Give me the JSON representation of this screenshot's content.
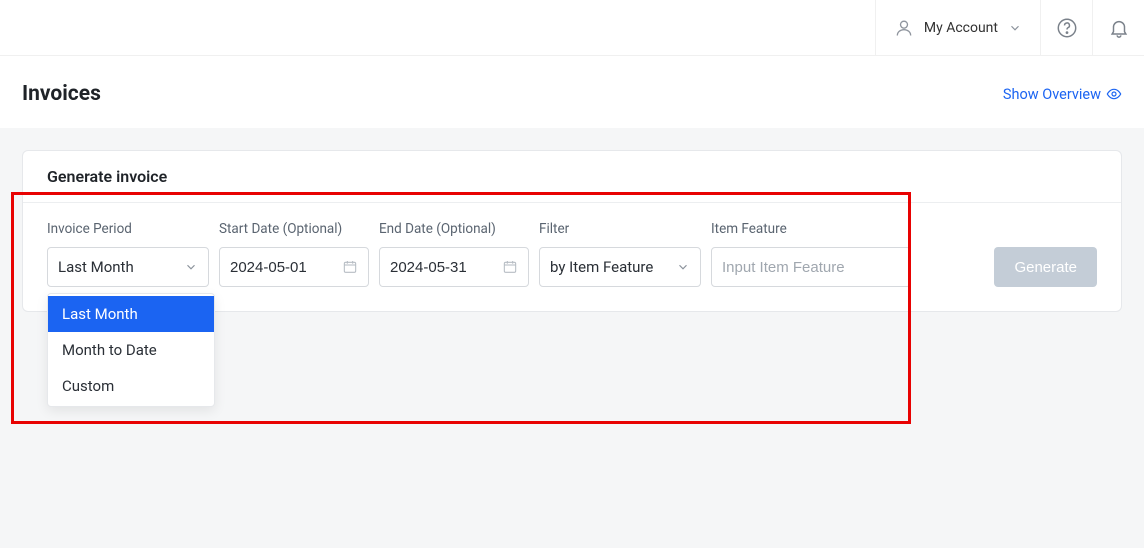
{
  "header": {
    "account_label": "My Account"
  },
  "page": {
    "title": "Invoices",
    "overview_label": "Show Overview"
  },
  "card": {
    "title": "Generate invoice"
  },
  "fields": {
    "invoice_period": {
      "label": "Invoice Period",
      "value": "Last Month"
    },
    "start_date": {
      "label": "Start Date (Optional)",
      "value": "2024-05-01"
    },
    "end_date": {
      "label": "End Date (Optional)",
      "value": "2024-05-31"
    },
    "filter": {
      "label": "Filter",
      "value": "by Item Feature"
    },
    "item_feature": {
      "label": "Item Feature",
      "placeholder": "Input Item Feature"
    }
  },
  "dropdown_options": {
    "opt0": "Last Month",
    "opt1": "Month to Date",
    "opt2": "Custom"
  },
  "buttons": {
    "generate": "Generate"
  }
}
